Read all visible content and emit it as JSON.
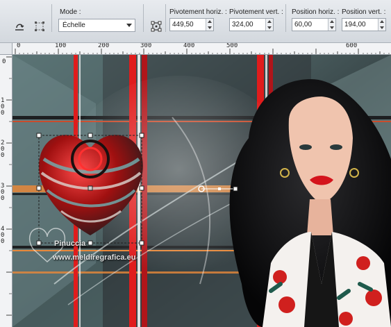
{
  "toolbar": {
    "mode_label": "Mode :",
    "mode_value": "Échelle",
    "pivot_h_label": "Pivotement horiz. :",
    "pivot_h_value": "449,50",
    "pivot_v_label": "Pivotement vert. :",
    "pivot_v_value": "324,00",
    "pos_h_label": "Position horiz. :",
    "pos_h_value": "60,00",
    "pos_v_label": "Position vert. :",
    "pos_v_value": "194,00",
    "icons": [
      "reset-transform-icon",
      "selection-grid-icon",
      "rotate-pivot-icon"
    ]
  },
  "rulers": {
    "horizontal": [
      "0",
      "100",
      "200",
      "300",
      "400",
      "500",
      "600"
    ],
    "vertical": [
      "0",
      "100",
      "200",
      "300",
      "400"
    ]
  },
  "canvas": {
    "watermark_line1": "Pinuccia",
    "watermark_line2": "www.meldiregrafica.eu",
    "accent_red": "#e01c1c",
    "accent_orange": "#e8883a",
    "background_teal": "#5f7a7c"
  }
}
